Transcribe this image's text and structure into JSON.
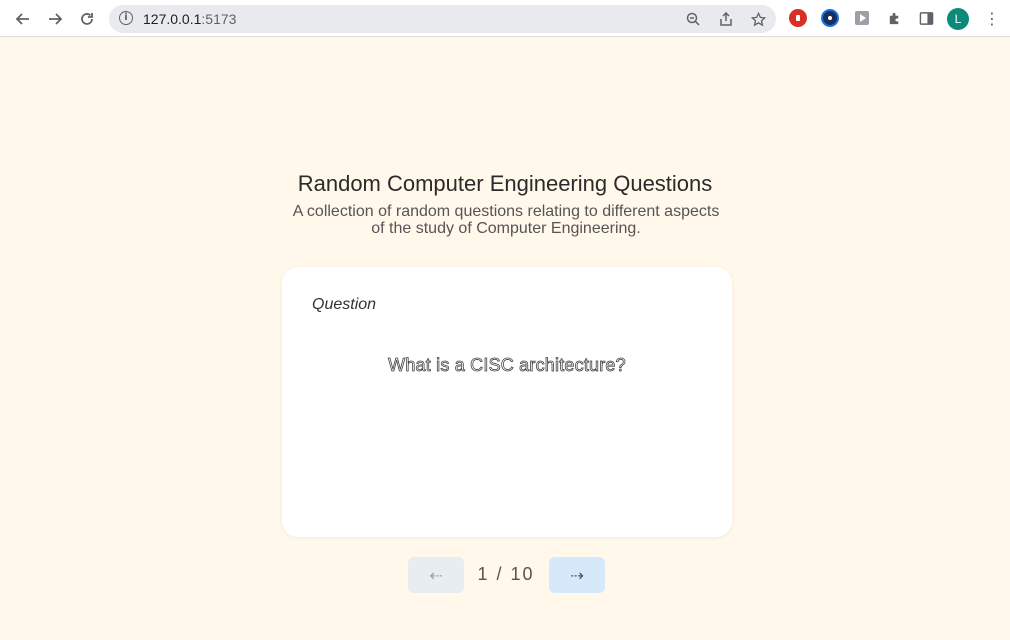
{
  "browser": {
    "url_host": "127.0.0.1",
    "url_port": ":5173",
    "avatar_letter": "L",
    "icons": {
      "back": "arrow-left-icon",
      "forward": "arrow-right-icon",
      "reload": "reload-icon",
      "info": "info-icon",
      "zoom": "zoom-icon",
      "share": "share-icon",
      "bookmark": "star-icon",
      "extensions": "puzzle-icon",
      "sidepanel": "side-panel-icon",
      "menu": "more-vert-icon"
    },
    "ext_colors": [
      "#d93025",
      "#1a73e8",
      "#5f6368"
    ]
  },
  "page": {
    "title": "Random Computer Engineering Questions",
    "subtitle": "A collection of random questions relating to different aspects of the study of Computer Engineering."
  },
  "card": {
    "label": "Question",
    "question": "What is a CISC architecture?"
  },
  "pager": {
    "prev_symbol": "⇠",
    "next_symbol": "⇢",
    "counter": "1 / 10"
  },
  "colors": {
    "page_background": "#fff8eb",
    "next_button": "#d5e9fb",
    "prev_button": "#e8edf2"
  }
}
